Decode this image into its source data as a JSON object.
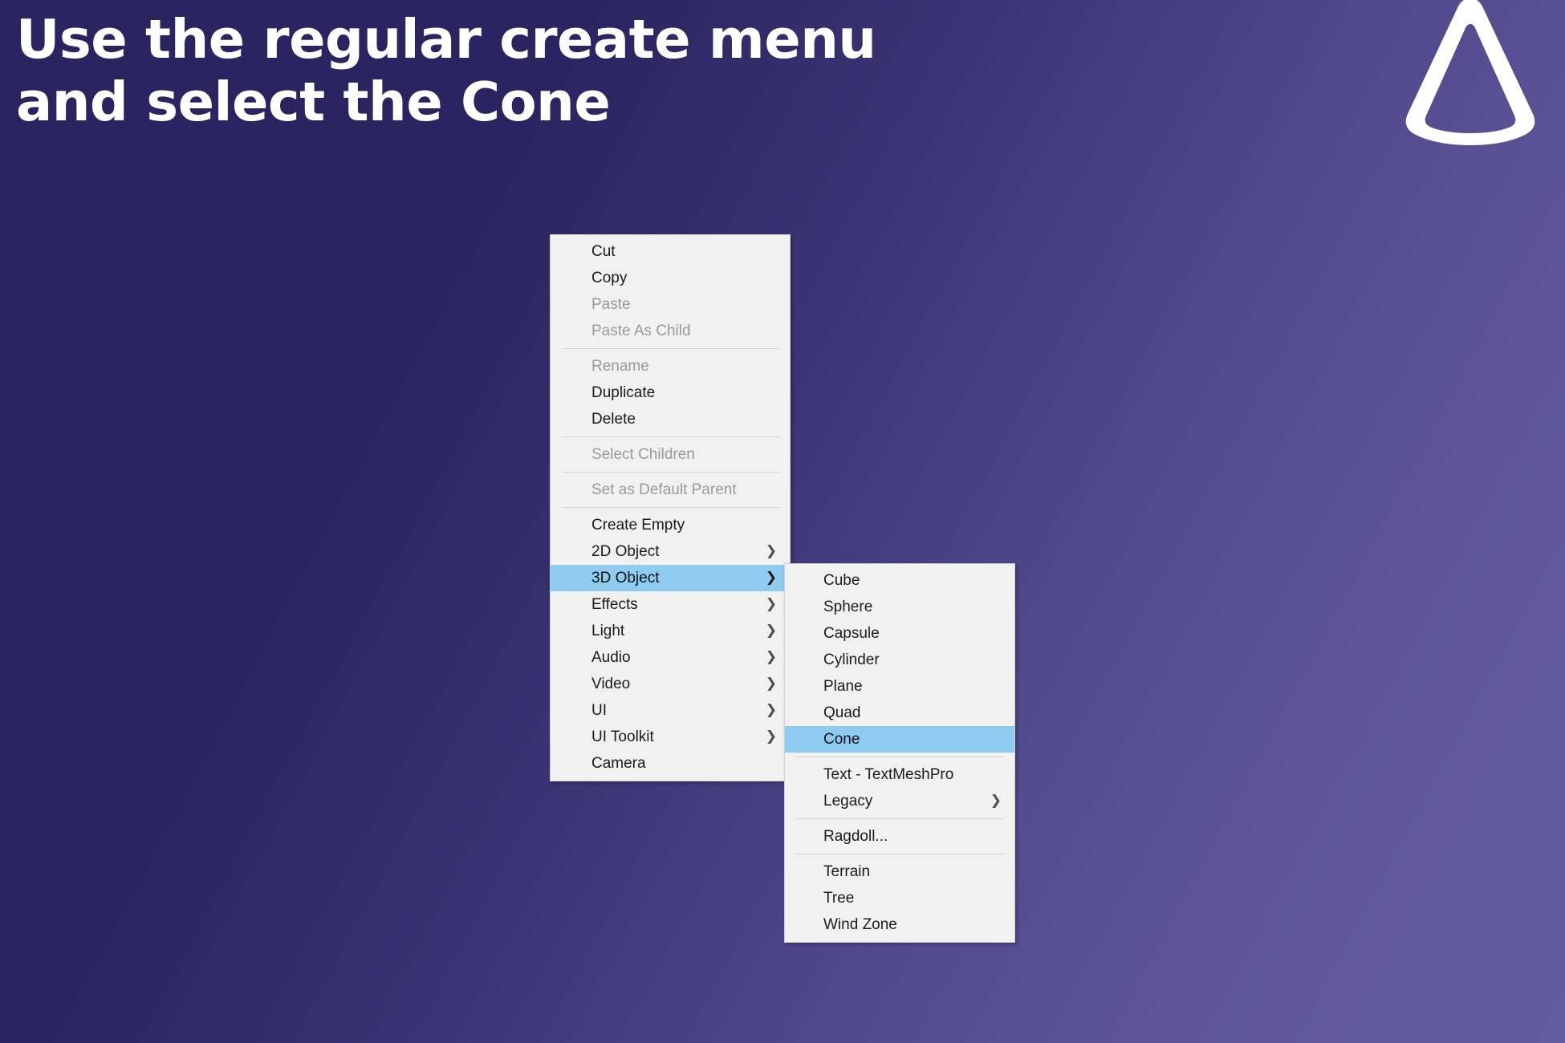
{
  "slide": {
    "headline": "Use the regular create menu\nand select the Cone",
    "background_color_start": "#2a2560",
    "background_color_end": "#645ba0",
    "logo_icon": "cone-outline-icon",
    "logo_color": "#ffffff"
  },
  "context_menu": {
    "name": "hierarchy-context-menu",
    "highlight_color": "#8ecbf0",
    "background_color": "#f1f1f1",
    "groups": [
      {
        "items": [
          {
            "label": "Cut",
            "disabled": false,
            "submenu": false,
            "selected": false
          },
          {
            "label": "Copy",
            "disabled": false,
            "submenu": false,
            "selected": false
          },
          {
            "label": "Paste",
            "disabled": true,
            "submenu": false,
            "selected": false
          },
          {
            "label": "Paste As Child",
            "disabled": true,
            "submenu": false,
            "selected": false
          }
        ]
      },
      {
        "items": [
          {
            "label": "Rename",
            "disabled": true,
            "submenu": false,
            "selected": false
          },
          {
            "label": "Duplicate",
            "disabled": false,
            "submenu": false,
            "selected": false
          },
          {
            "label": "Delete",
            "disabled": false,
            "submenu": false,
            "selected": false
          }
        ]
      },
      {
        "items": [
          {
            "label": "Select Children",
            "disabled": true,
            "submenu": false,
            "selected": false
          }
        ]
      },
      {
        "items": [
          {
            "label": "Set as Default Parent",
            "disabled": true,
            "submenu": false,
            "selected": false
          }
        ]
      },
      {
        "items": [
          {
            "label": "Create Empty",
            "disabled": false,
            "submenu": false,
            "selected": false
          },
          {
            "label": "2D Object",
            "disabled": false,
            "submenu": true,
            "selected": false
          },
          {
            "label": "3D Object",
            "disabled": false,
            "submenu": true,
            "selected": true
          },
          {
            "label": "Effects",
            "disabled": false,
            "submenu": true,
            "selected": false
          },
          {
            "label": "Light",
            "disabled": false,
            "submenu": true,
            "selected": false
          },
          {
            "label": "Audio",
            "disabled": false,
            "submenu": true,
            "selected": false
          },
          {
            "label": "Video",
            "disabled": false,
            "submenu": true,
            "selected": false
          },
          {
            "label": "UI",
            "disabled": false,
            "submenu": true,
            "selected": false
          },
          {
            "label": "UI Toolkit",
            "disabled": false,
            "submenu": true,
            "selected": false
          },
          {
            "label": "Camera",
            "disabled": false,
            "submenu": false,
            "selected": false
          }
        ]
      }
    ]
  },
  "submenu_3d_object": {
    "name": "3d-object-submenu",
    "groups": [
      {
        "items": [
          {
            "label": "Cube",
            "disabled": false,
            "submenu": false,
            "selected": false
          },
          {
            "label": "Sphere",
            "disabled": false,
            "submenu": false,
            "selected": false
          },
          {
            "label": "Capsule",
            "disabled": false,
            "submenu": false,
            "selected": false
          },
          {
            "label": "Cylinder",
            "disabled": false,
            "submenu": false,
            "selected": false
          },
          {
            "label": "Plane",
            "disabled": false,
            "submenu": false,
            "selected": false
          },
          {
            "label": "Quad",
            "disabled": false,
            "submenu": false,
            "selected": false
          },
          {
            "label": "Cone",
            "disabled": false,
            "submenu": false,
            "selected": true
          }
        ]
      },
      {
        "items": [
          {
            "label": "Text - TextMeshPro",
            "disabled": false,
            "submenu": false,
            "selected": false
          },
          {
            "label": "Legacy",
            "disabled": false,
            "submenu": true,
            "selected": false
          }
        ]
      },
      {
        "items": [
          {
            "label": "Ragdoll...",
            "disabled": false,
            "submenu": false,
            "selected": false
          }
        ]
      },
      {
        "items": [
          {
            "label": "Terrain",
            "disabled": false,
            "submenu": false,
            "selected": false
          },
          {
            "label": "Tree",
            "disabled": false,
            "submenu": false,
            "selected": false
          },
          {
            "label": "Wind Zone",
            "disabled": false,
            "submenu": false,
            "selected": false
          }
        ]
      }
    ]
  },
  "icons": {
    "submenu_arrow": "chevron-right-icon"
  }
}
